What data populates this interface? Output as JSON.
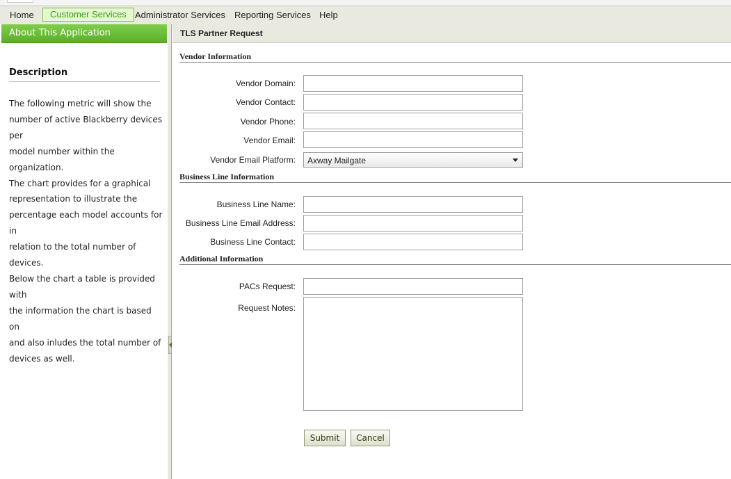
{
  "menu": {
    "items": [
      {
        "label": "Home"
      },
      {
        "label": "Customer Services"
      },
      {
        "label": "Administrator Services"
      },
      {
        "label": "Reporting Services"
      },
      {
        "label": "Help"
      }
    ]
  },
  "sidebar": {
    "header": "About This Application",
    "description_title": "Description",
    "description_lines": [
      "The following metric will show the",
      "number of active Blackberry devices per",
      "model number within the organization.",
      "The chart provides for a graphical",
      "representation to illustrate the",
      "percentage each model accounts for in",
      "relation to the total number of devices.",
      "Below the chart a table is provided with",
      "the information the chart is based on",
      "and also inludes the total number of",
      "devices as well."
    ]
  },
  "main": {
    "title": "TLS Partner Request",
    "sections": {
      "vendor": "Vendor Information",
      "business": "Business Line Information",
      "additional": "Additional Information"
    },
    "fields": {
      "vendor_domain": {
        "label": "Vendor Domain:",
        "value": ""
      },
      "vendor_contact": {
        "label": "Vendor Contact:",
        "value": ""
      },
      "vendor_phone": {
        "label": "Vendor Phone:",
        "value": ""
      },
      "vendor_email": {
        "label": "Vendor Email:",
        "value": ""
      },
      "vendor_email_platform": {
        "label": "Vendor Email Platform:",
        "value": "Axway Mailgate"
      },
      "business_line_name": {
        "label": "Business Line Name:",
        "value": ""
      },
      "business_line_email": {
        "label": "Business Line Email Address:",
        "value": ""
      },
      "business_line_contact": {
        "label": "Business Line Contact:",
        "value": ""
      },
      "pacs_request": {
        "label": "PACs Request:",
        "value": ""
      },
      "request_notes": {
        "label": "Request Notes:",
        "value": ""
      }
    },
    "buttons": {
      "submit": "Submit",
      "cancel": "Cancel"
    }
  },
  "colors": {
    "accent_green": "#5cad2c",
    "active_tab_bg": "#e4f7cf",
    "active_tab_text": "#3a9b1c",
    "toolbar_bg": "#e9e9e0"
  }
}
